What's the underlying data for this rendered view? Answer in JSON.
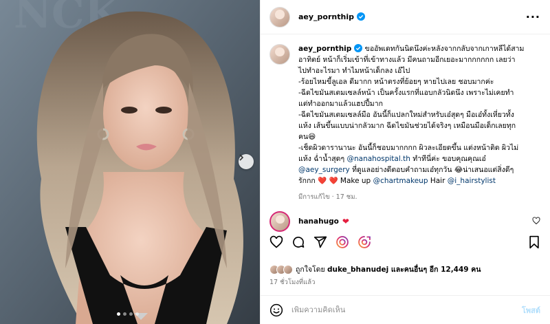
{
  "post": {
    "username": "aey_pornthip",
    "caption_lines": [
      "ขออัพเดทกันนิดนึงค่ะหลังจากกลับจากเกาหลีได้สาม",
      "อาทิตย์ หน้าก็เริ่มเข้าที่เข้าทางแล้ว มีคนถามอีกเยอะมากกกกกก เลยว่า",
      "ไปทำอะไรมา ทำไมหน้าเด็กลง เอ๊ไป",
      "-ร้อยไหมขี้ลูเอล ดีมากก หน้าตรงที่ย้อยๆ หายไปเลย ชอบมากค่ะ",
      "-ฉีดไขมันสเตมเซลล์หน้า เป็นครั้งแรกที่แอบกลัวนิดนึง เพราะไม่เคยทำ",
      "แต่ทำออกมาแล้วแฮปปี้มาก",
      "-ฉีดไขมันสเตมเซลล์มือ อันนี้ก็แปลกใหม่สำหรับเอ๋สุดๆ มือเอ๋ทั้งเหี่ยวทั้ง",
      "แห้ง เส้นขึ้นแบบน่ากลัวมาก ฉีดไขมันช่วยได้จริงๆ เหมือนมือเด็กเลยทุก",
      "คน😆",
      "-เช็ดผิวดารานานะ อันนี้ก็ชอบมากกกก ผิวละเอียดขึ้น แต่งหน้าติด ผิวไม่",
      "แห้ง ฉ่ำน้ำสุดๆ"
    ],
    "mention_hospital": "@nanahospital.th",
    "after_hospital": " ทำทีนี่ค่ะ ขอบคุณคุณเอ๋",
    "mention_surgery": "@aey_surgery",
    "after_surgery": " ที่ดูแลอย่างดีตอบคำถามเอ๋ทุกวัน 😂น่าเสนอแต่สิ่งดีๆ",
    "line_last_start": "รักกก ",
    "hearts": "❤️ ❤️",
    "makeup_label": " Make up ",
    "mention_makeup": "@chartmakeup",
    "hair_label": " Hair ",
    "mention_hair": "@i_hairstylist",
    "edited_label": "มีการแก้ไข",
    "edited_time": "17 ชม.",
    "reply_user": "hanahugo",
    "reply_text": "❤",
    "liked_by_prefix": "ถูกใจโดย ",
    "liked_by_user": "duke_bhanudej",
    "liked_by_suffix": " และคนอื่นๆ อีก 12,449 คน",
    "posted_time": "17 ชั่วโมงที่แล้ว",
    "comment_placeholder": "เพิ่มความคิดเห็น",
    "post_button": "โพสต์"
  },
  "colors": {
    "verified": "#0095f6",
    "link": "#00376b",
    "heart": "#e41e3f",
    "post_button": "#b2dffc"
  },
  "icons": [
    "verified-badge-icon",
    "more-options-icon",
    "next-arrow-icon",
    "heart-icon",
    "comment-icon",
    "share-icon",
    "repost-icon",
    "save-icon",
    "emoji-icon"
  ],
  "carousel": {
    "slides": 4,
    "active": 1
  }
}
